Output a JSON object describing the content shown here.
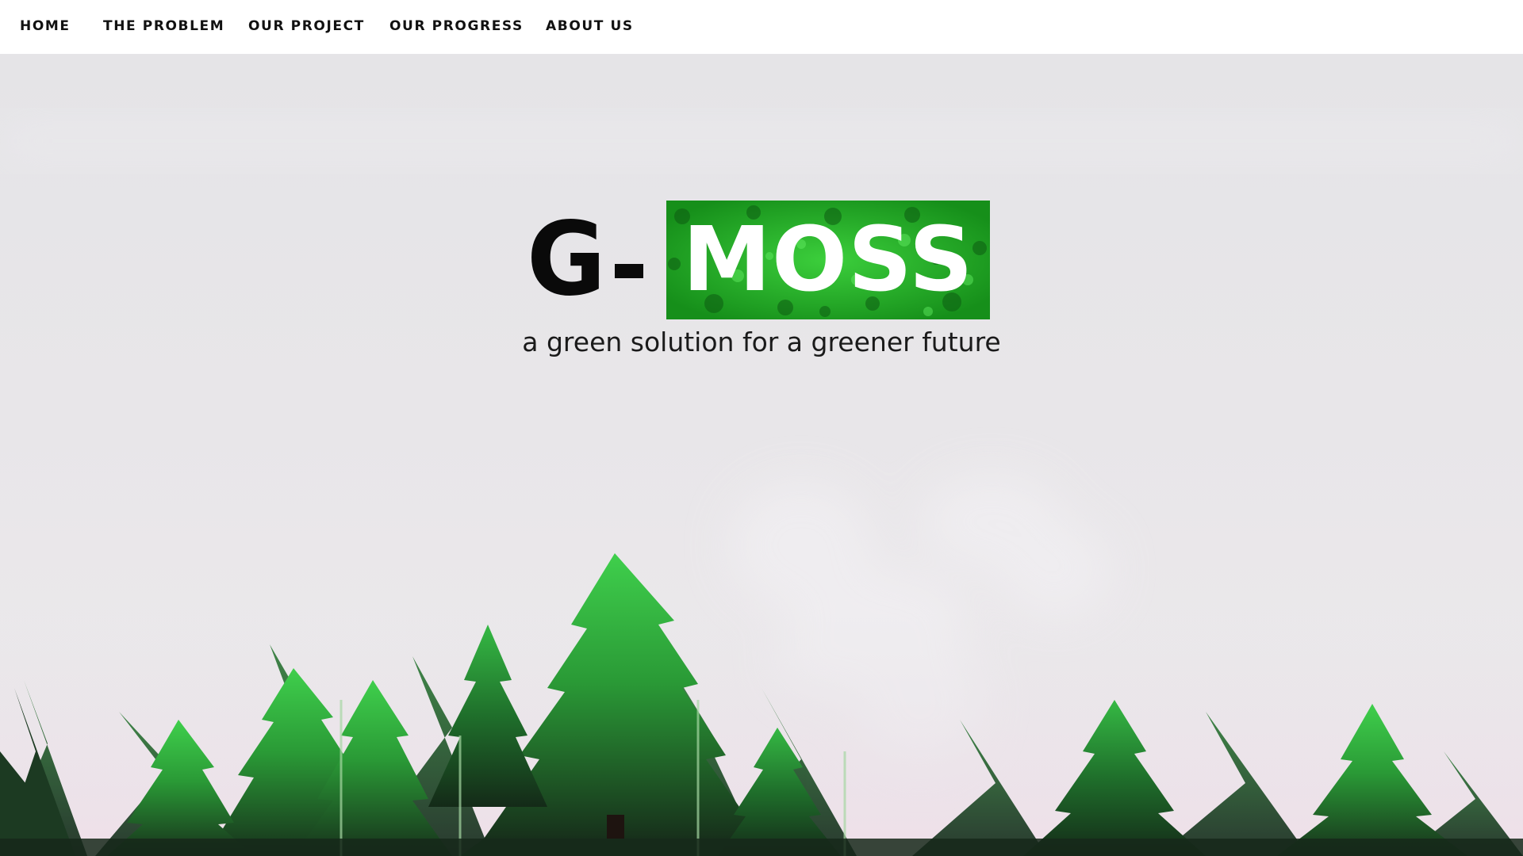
{
  "nav": {
    "items": [
      {
        "label": "HOME"
      },
      {
        "label": "THE PROBLEM"
      },
      {
        "label": "OUR PROJECT"
      },
      {
        "label": "OUR PROGRESS"
      },
      {
        "label": "ABOUT US"
      }
    ]
  },
  "hero": {
    "logo": {
      "prefix": "G",
      "separator": "-",
      "highlight": "MOSS"
    },
    "tagline": "a green solution for a greener future"
  },
  "colors": {
    "nav_background": "#ffffff",
    "nav_text": "#111111",
    "hero_background": "#e6e5e8",
    "moss_green": "#22a322",
    "tree_green": "#2f9a3a",
    "tree_dark": "#1c3b22",
    "logo_text": "#0a0a0a"
  }
}
